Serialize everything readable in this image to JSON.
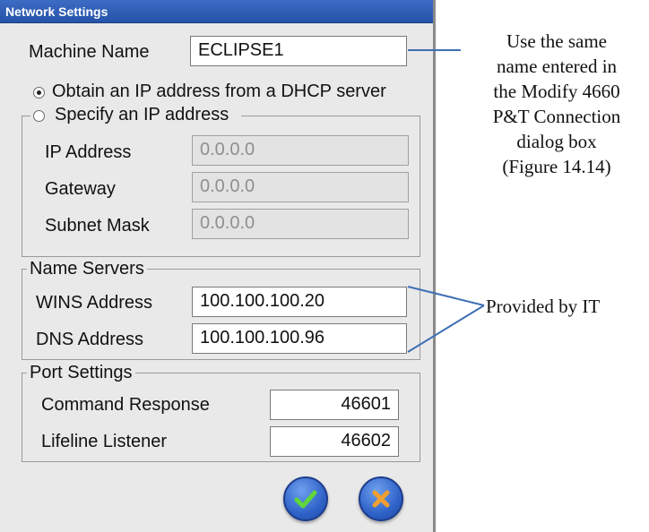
{
  "dialog": {
    "title": "Network Settings",
    "machine_name_label": "Machine Name",
    "machine_name_value": "ECLIPSE1",
    "dhcp_option_label": "Obtain an IP address from a DHCP server",
    "static_option_label": "Specify an IP address",
    "selected_option": "dhcp",
    "ip_address_label": "IP Address",
    "ip_address_value": "0.0.0.0",
    "gateway_label": "Gateway",
    "gateway_value": "0.0.0.0",
    "subnet_mask_label": "Subnet Mask",
    "subnet_mask_value": "0.0.0.0",
    "name_servers_title": "Name Servers",
    "wins_label": "WINS Address",
    "wins_value": "100.100.100.20",
    "dns_label": "DNS Address",
    "dns_value": "100.100.100.96",
    "port_settings_title": "Port Settings",
    "command_response_label": "Command Response",
    "command_response_value": "46601",
    "lifeline_listener_label": "Lifeline Listener",
    "lifeline_listener_value": "46602",
    "ok_icon": "check-icon",
    "cancel_icon": "x-icon"
  },
  "annotations": {
    "machine_name_note_lines": [
      "Use the same",
      "name entered in",
      "the Modify 4660",
      "P&T Connection",
      "dialog box",
      "(Figure 14.14)"
    ],
    "name_servers_note": "Provided by IT"
  },
  "colors": {
    "titlebar": "#2d5db8",
    "ok_button": "#2f63c8",
    "cancel_button": "#2f63c8",
    "check_mark": "#5fd63c",
    "x_mark": "#f0a030",
    "callout_line": "#3e6fb5"
  }
}
